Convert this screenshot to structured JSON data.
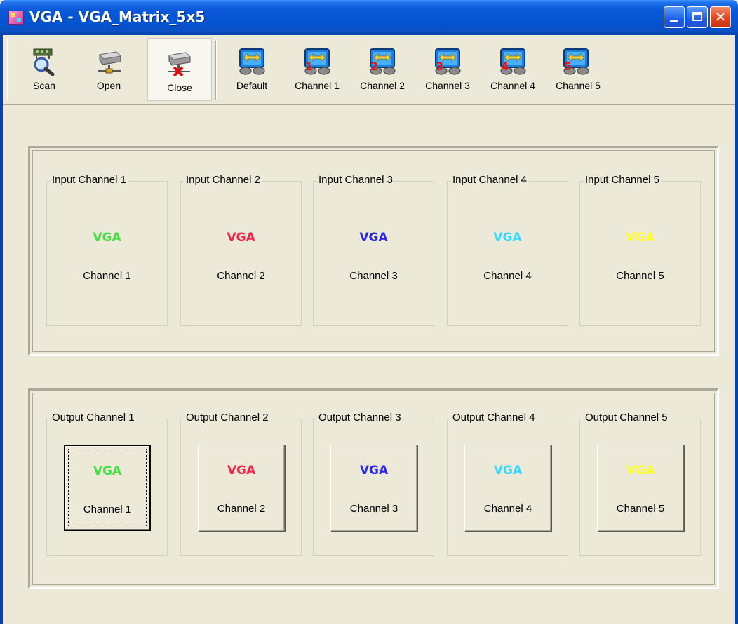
{
  "window": {
    "title": "VGA - VGA_Matrix_5x5"
  },
  "toolbar": {
    "buttons": [
      {
        "label": "Scan",
        "icon": "scan-icon"
      },
      {
        "label": "Open",
        "icon": "open-device-icon"
      },
      {
        "label": "Close",
        "icon": "close-device-icon",
        "pressed": true
      },
      {
        "label": "Default",
        "icon": "monitor-swap-icon"
      },
      {
        "label": "Channel 1",
        "icon": "monitor-swap-1-icon"
      },
      {
        "label": "Channel 2",
        "icon": "monitor-swap-2-icon"
      },
      {
        "label": "Channel 3",
        "icon": "monitor-swap-3-icon"
      },
      {
        "label": "Channel 4",
        "icon": "monitor-swap-4-icon"
      },
      {
        "label": "Channel 5",
        "icon": "monitor-swap-5-icon"
      }
    ],
    "badges": [
      "1",
      "2",
      "3",
      "4",
      "5"
    ]
  },
  "colors": {
    "vga_1": "#44e044",
    "vga_2": "#f0284e",
    "vga_3": "#2a2ae0",
    "vga_4": "#3ad8ff",
    "vga_5": "#ffff1c"
  },
  "inputs": [
    {
      "title": "Input Channel 1",
      "vga": "VGA",
      "channel": "Channel 1"
    },
    {
      "title": "Input Channel 2",
      "vga": "VGA",
      "channel": "Channel 2"
    },
    {
      "title": "Input Channel 3",
      "vga": "VGA",
      "channel": "Channel 3"
    },
    {
      "title": "Input Channel 4",
      "vga": "VGA",
      "channel": "Channel 4"
    },
    {
      "title": "Input Channel 5",
      "vga": "VGA",
      "channel": "Channel 5"
    }
  ],
  "outputs": [
    {
      "title": "Output Channel 1",
      "vga": "VGA",
      "channel": "Channel 1"
    },
    {
      "title": "Output Channel 2",
      "vga": "VGA",
      "channel": "Channel 2"
    },
    {
      "title": "Output Channel 3",
      "vga": "VGA",
      "channel": "Channel 3"
    },
    {
      "title": "Output Channel 4",
      "vga": "VGA",
      "channel": "Channel 4"
    },
    {
      "title": "Output Channel 5",
      "vga": "VGA",
      "channel": "Channel 5"
    }
  ]
}
